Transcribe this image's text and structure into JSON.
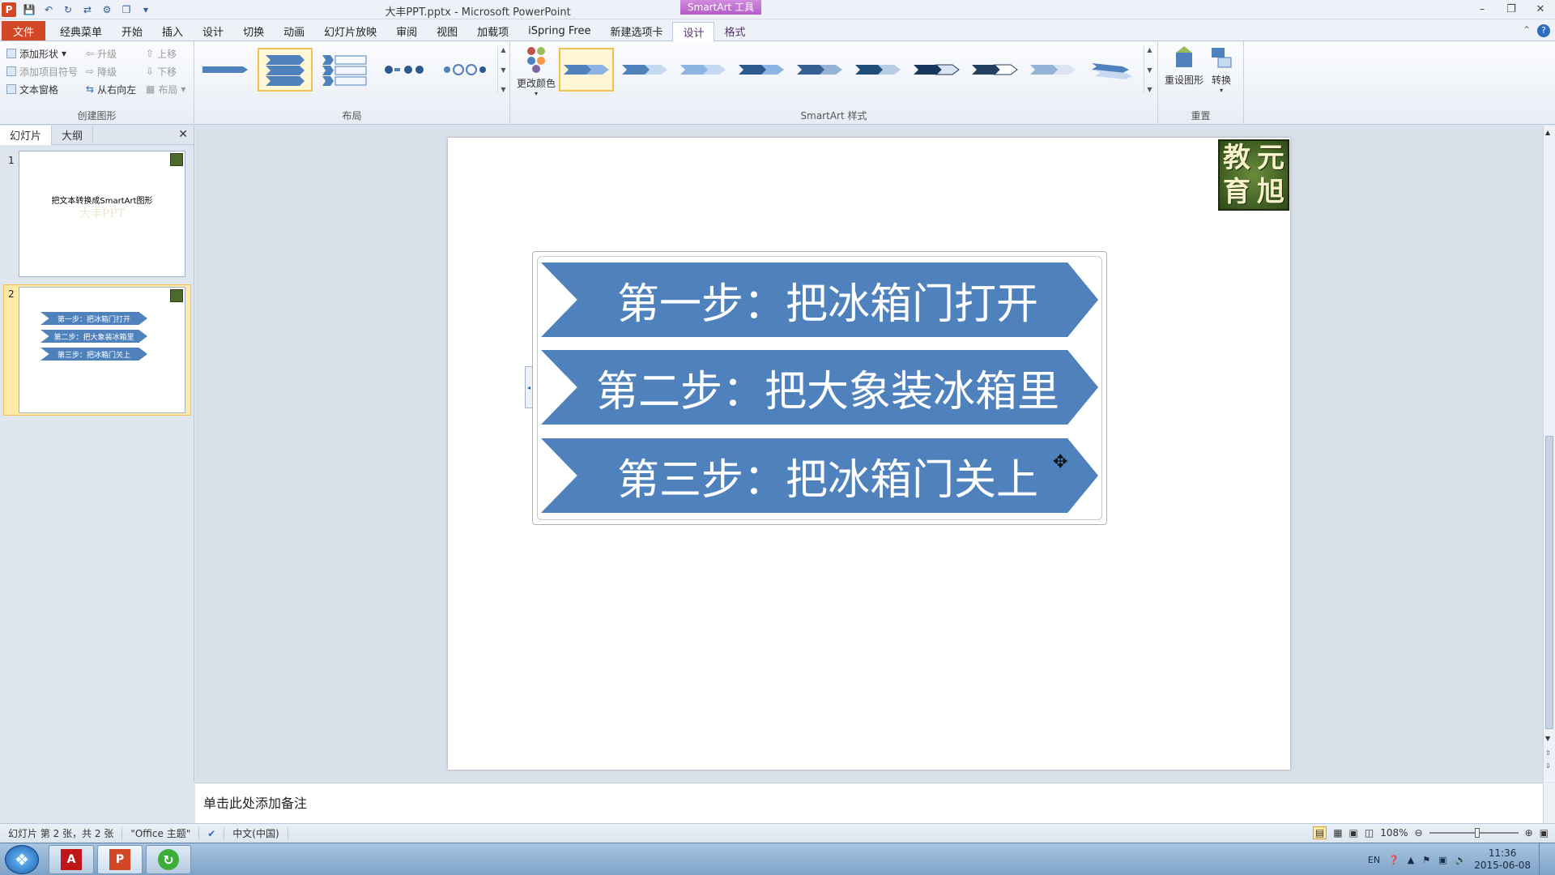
{
  "window": {
    "title": "大丰PPT.pptx - Microsoft PowerPoint",
    "context_tag": "SmartArt 工具"
  },
  "tabs": [
    "文件",
    "经典菜单",
    "开始",
    "插入",
    "设计",
    "切换",
    "动画",
    "幻灯片放映",
    "审阅",
    "视图",
    "加载项",
    "iSpring Free",
    "新建选项卡",
    "设计",
    "格式"
  ],
  "ribbon": {
    "create_graphic": {
      "add_shape": "添加形状",
      "add_bullet": "添加项目符号",
      "text_pane": "文本窗格",
      "promote": "升级",
      "demote": "降级",
      "right_to_left": "从右向左",
      "move_up": "上移",
      "move_down": "下移",
      "layout_btn": "布局",
      "label": "创建图形"
    },
    "layouts_label": "布局",
    "change_colors": "更改颜色",
    "styles_label": "SmartArt 样式",
    "reset_graphic": "重设图形",
    "convert": "转换",
    "reset_label": "重置"
  },
  "left_panel": {
    "tab_slides": "幻灯片",
    "tab_outline": "大纲",
    "slides": [
      {
        "num": "1",
        "title": "把文本转换成SmartArt图形",
        "watermark": "大丰PPT"
      },
      {
        "num": "2",
        "items": [
          "第一步：把冰箱门打开",
          "第二步：把大象装冰箱里",
          "第三步：把冰箱门关上"
        ]
      }
    ]
  },
  "slide": {
    "logo_chars": [
      "教",
      "元",
      "育",
      "旭"
    ],
    "steps": [
      "第一步：把冰箱门打开",
      "第二步：把大象装冰箱里",
      "第三步：把冰箱门关上"
    ],
    "arrow_color": "#4f81bd"
  },
  "notes": {
    "placeholder": "单击此处添加备注"
  },
  "status": {
    "slide_info": "幻灯片 第 2 张，共 2 张",
    "theme": "\"Office 主题\"",
    "language": "中文(中国)",
    "zoom": "108%"
  },
  "tray": {
    "lang": "EN",
    "time": "11:36",
    "date": "2015-06-08"
  }
}
